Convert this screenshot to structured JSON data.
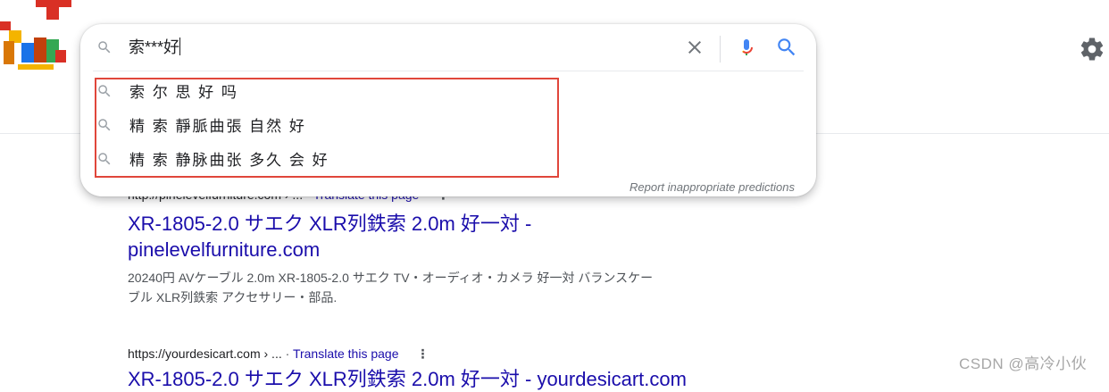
{
  "search": {
    "query": "索***好",
    "suggestions": [
      "索 尔 思 好 吗",
      "精 索 靜脈曲張 自然 好",
      "精 索 静脉曲张 多久 会 好"
    ],
    "report_label": "Report inappropriate predictions"
  },
  "results": [
    {
      "cite": "http://pinelevelfurniture.com › ...",
      "translate": "Translate this page",
      "title_line1": "XR-1805-2.0 サエク XLR列鉄索 2.0m 好一対 -",
      "title_line2": "pinelevelfurniture.com",
      "snippet_line1": "20240円 AVケーブル 2.0m XR-1805-2.0 サエク TV・オーディオ・カメラ 好一対 バランスケー",
      "snippet_line2": "ブル XLR列鉄索 アクセサリー・部品."
    },
    {
      "cite": "https://yourdesicart.com › ...",
      "dot": "·",
      "translate": "Translate this page",
      "title_line1": "XR-1805-2.0 サエク XLR列鉄索 2.0m 好一対 - yourdesicart.com"
    }
  ],
  "watermark": "CSDN @高冷小伙",
  "icons": {
    "search": "search-icon",
    "clear": "close-icon",
    "mic": "mic-icon",
    "search_button": "search-icon",
    "settings": "gear-icon",
    "more": "more-vert-icon",
    "logo": "google-doodle-logo"
  },
  "colors": {
    "link": "#1a0dab",
    "highlight_box": "#e0463b",
    "mic_blue": "#4285f4",
    "mic_red": "#ea4335"
  }
}
